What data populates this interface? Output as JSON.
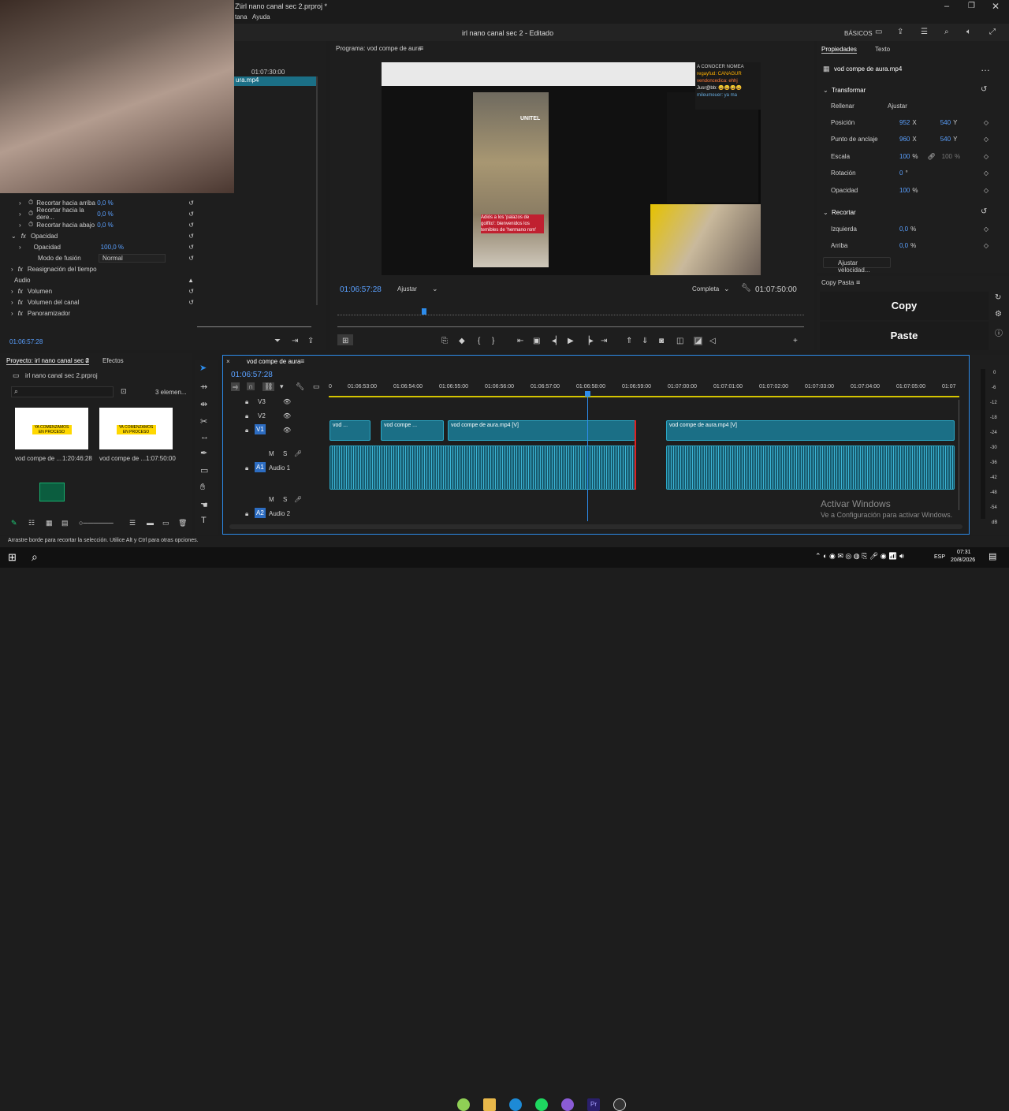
{
  "window": {
    "title": "Z\\irl nano canal sec 2.prproj *",
    "menu": [
      "tana",
      "Ayuda"
    ],
    "project_title": "irl nano canal sec 2 - Editado",
    "workspace": "BÁSICOS"
  },
  "source": {
    "time_ruler": "01:07:30:00",
    "clip_label": "ura.mp4",
    "current_time": "01:06:57:28"
  },
  "effect_controls": {
    "rows": [
      {
        "label": "Recortar hacia arriba",
        "value": "0,0 %"
      },
      {
        "label": "Recortar hacia la dere...",
        "value": "0,0 %"
      },
      {
        "label": "Recortar hacia abajo",
        "value": "0,0 %"
      },
      {
        "label": "Opacidad",
        "value": ""
      },
      {
        "label": "Opacidad",
        "value": "100,0 %"
      },
      {
        "label": "Modo de fusión",
        "value": "Normal"
      },
      {
        "label": "Reasignación del tiempo",
        "value": ""
      },
      {
        "label": "Audio",
        "value": ""
      },
      {
        "label": "Volumen",
        "value": ""
      },
      {
        "label": "Volumen del canal",
        "value": ""
      },
      {
        "label": "Panoramizador",
        "value": ""
      }
    ]
  },
  "program": {
    "title": "Programa: vod compe de aura",
    "timecode": "01:06:57:28",
    "fit": "Ajustar",
    "quality": "Completa",
    "duration": "01:07:50:00",
    "video": {
      "logo": "UNITEL",
      "caption": "Adiós a los 'palazos de golfito': bienvenidos los temibles de 'hermano rom'",
      "chat_lines": [
        "A CONOCER NOMEA",
        "regayfud: CANAGUR",
        "vendoncedica: ehhj",
        "Jusr@bb: 😀😀😀😀",
        "mileumeuer: ya ma"
      ]
    }
  },
  "properties": {
    "tabs": [
      "Propiedades",
      "Texto"
    ],
    "file": "vod compe de aura.mp4",
    "section_transform": "Transformar",
    "fill": "Rellenar",
    "fit": "Ajustar",
    "props": [
      {
        "label": "Posición",
        "x": "952",
        "xu": "X",
        "y": "540",
        "yu": "Y"
      },
      {
        "label": "Punto de anclaje",
        "x": "960",
        "xu": "X",
        "y": "540",
        "yu": "Y"
      },
      {
        "label": "Escala",
        "x": "100",
        "xu": "%",
        "y": "100",
        "yu": "%"
      },
      {
        "label": "Rotación",
        "x": "0",
        "xu": "°",
        "y": "",
        "yu": ""
      },
      {
        "label": "Opacidad",
        "x": "100",
        "xu": "%",
        "y": "",
        "yu": ""
      }
    ],
    "section_crop": "Recortar",
    "crop": [
      {
        "label": "Izquierda",
        "v": "0,0",
        "u": "%"
      },
      {
        "label": "Arriba",
        "v": "0,0",
        "u": "%"
      }
    ],
    "speed_button": "Ajustar velocidad..."
  },
  "copy_paste": {
    "title": "Copy Pasta",
    "copy": "Copy",
    "paste": "Paste"
  },
  "project": {
    "tab": "Proyecto: irl nano canal sec 2",
    "effects_tab": "Efectos",
    "file": "irl nano canal sec 2.prproj",
    "count": "3 elemen...",
    "items": [
      {
        "name": "vod compe de ...",
        "duration": "1:20:46:28",
        "thumb_text": "YA COMENZAMOS EN PROCESO"
      },
      {
        "name": "vod compe de ...",
        "duration": "1:07:50:00",
        "thumb_text": "YA COMENZAMOS EN PROCESO"
      }
    ]
  },
  "timeline": {
    "tab": "vod compe de aura",
    "timecode": "01:06:57:28",
    "ticks": [
      "0",
      "01:06:53:00",
      "01:06:54:00",
      "01:06:55:00",
      "01:06:56:00",
      "01:06:57:00",
      "01:06:58:00",
      "01:06:59:00",
      "01:07:00:00",
      "01:07:01:00",
      "01:07:02:00",
      "01:07:03:00",
      "01:07:04:00",
      "01:07:05:00",
      "01:07"
    ],
    "tracks": {
      "v3": "V3",
      "v2": "V2",
      "v1": "V1",
      "a1": "A1",
      "a1_name": "Audio 1",
      "a2": "A2",
      "a2_name": "Audio 2"
    },
    "clips": {
      "c1": "vod ...",
      "c2": "vod compe ...",
      "c3": "vod compe de aura.mp4 [V]",
      "c4": "vod compe de aura.mp4 [V]"
    },
    "meter": [
      "0",
      "-6",
      "-12",
      "-18",
      "-24",
      "-30",
      "-36",
      "-42",
      "-48",
      "-54",
      "dB"
    ]
  },
  "status": {
    "hint": "Arrastre borde para recortar la selección. Utilice Alt y Ctrl para otras opciones."
  },
  "activation": {
    "title": "Activar Windows",
    "subtitle": "Ve a Configuración para activar Windows."
  },
  "taskbar": {
    "time": "07:31",
    "date": "20/8/2026",
    "lang": "ESP"
  },
  "colors": {
    "accent": "#2d8ceb",
    "clip": "#1b6f86",
    "playhead": "#2d8ceb"
  }
}
